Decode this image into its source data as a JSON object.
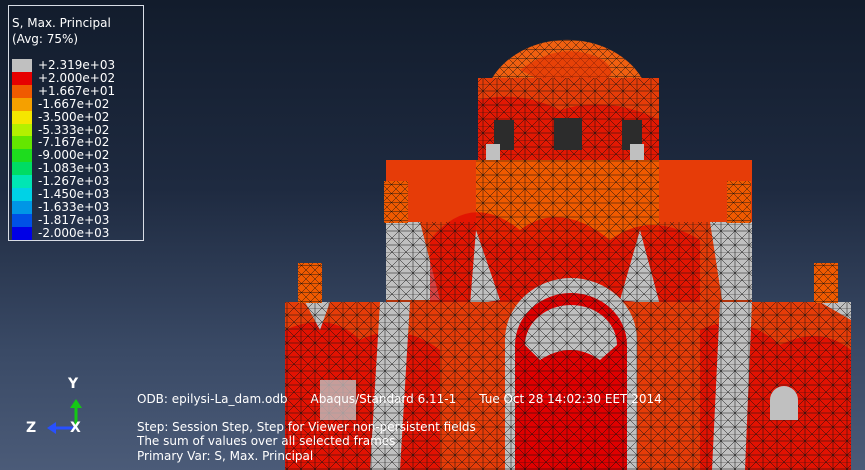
{
  "legend": {
    "title_line1": "S, Max. Principal",
    "title_line2": "(Avg: 75%)",
    "entries": [
      {
        "label": "+2.319e+03",
        "color": "#c0c0c0"
      },
      {
        "label": "+2.000e+02",
        "color": "#e60000"
      },
      {
        "label": "+1.667e+01",
        "color": "#f05a00"
      },
      {
        "label": "-1.667e+02",
        "color": "#f5a000"
      },
      {
        "label": "-3.500e+02",
        "color": "#f5e600"
      },
      {
        "label": "-5.333e+02",
        "color": "#b4f000"
      },
      {
        "label": "-7.167e+02",
        "color": "#64e600"
      },
      {
        "label": "-9.000e+02",
        "color": "#1edc1e"
      },
      {
        "label": "-1.083e+03",
        "color": "#00dc64"
      },
      {
        "label": "-1.267e+03",
        "color": "#00e6b4"
      },
      {
        "label": "-1.450e+03",
        "color": "#00d2e6"
      },
      {
        "label": "-1.633e+03",
        "color": "#0096e6"
      },
      {
        "label": "-1.817e+03",
        "color": "#0050e6"
      },
      {
        "label": "-2.000e+03",
        "color": "#0000e6"
      }
    ]
  },
  "info": {
    "odb": "ODB: epilysi-La_dam.odb",
    "solver": "Abaqus/Standard 6.11-1",
    "date": "Tue Oct 28 14:02:30 EET 2014",
    "step": "Step: Session Step, Step for Viewer non-persistent fields",
    "frames": "The sum of values over all selected frames",
    "primary_var": "Primary Var: S, Max. Principal"
  },
  "triad": {
    "y_label": "Y",
    "z_label": "Z",
    "x_label": "X",
    "y_color": "#14c814",
    "z_color": "#2850ff"
  },
  "colors": {
    "mesh": "#111111",
    "high_stress": "#e60000",
    "mid_stress": "#f05a00",
    "low_stress": "#c0c0c0"
  }
}
